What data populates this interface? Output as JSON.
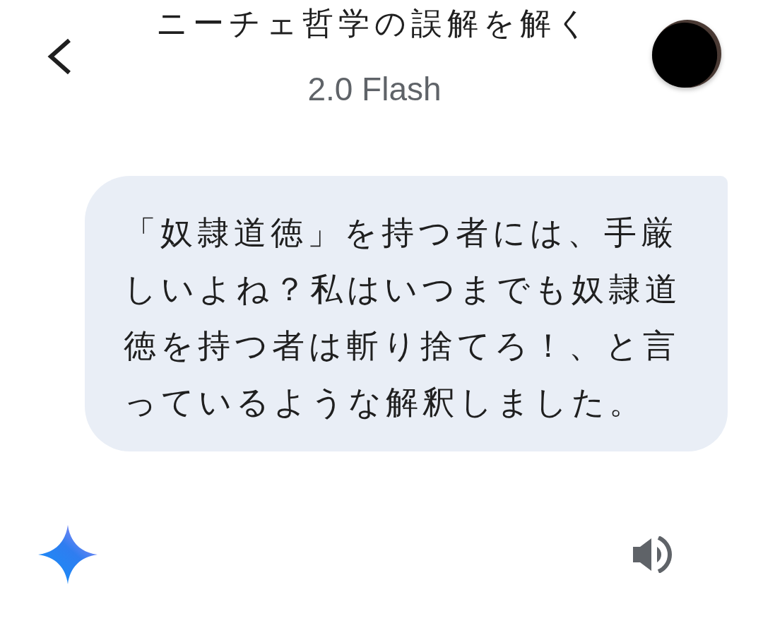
{
  "header": {
    "title": "ニーチェ哲学の誤解を解く",
    "subtitle": "2.0 Flash"
  },
  "messages": [
    {
      "kind": "user",
      "text": "「奴隷道徳」を持つ者には、手厳しいよね？私はいつまでも奴隷道徳を持つ者は斬り捨てろ！、と言っているような解釈しました。"
    }
  ]
}
